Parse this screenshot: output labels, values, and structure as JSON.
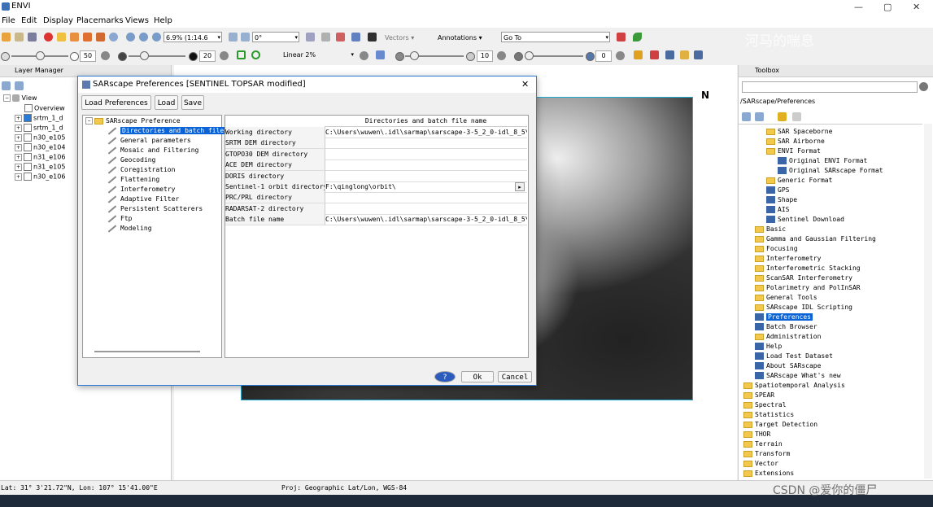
{
  "window": {
    "title": "ENVI",
    "min": "—",
    "max": "▢",
    "close": "✕"
  },
  "menu": [
    "File",
    "Edit",
    "Display",
    "Placemarks",
    "Views",
    "Help"
  ],
  "toolbar1": {
    "zoom": "6.9% (1:14.6",
    "rotation": "0°",
    "vectors": "Vectors ▾",
    "annotations": "Annotations ▾",
    "goto": "Go To"
  },
  "toolbar2": {
    "brightness": "50",
    "contrast": "20",
    "stretch": "Linear 2%",
    "sharpen": "10",
    "transparency": "0"
  },
  "layer_manager": {
    "title": "Layer Manager",
    "view": "View",
    "items": [
      "Overview",
      "srtm_1_d",
      "srtm_1_d",
      "n30_e105",
      "n30_e104",
      "n31_e106",
      "n31_e105",
      "n30_e106"
    ]
  },
  "toolbox": {
    "title": "Toolbox",
    "path": "/SARscape/Preferences",
    "items": [
      {
        "label": "SAR Spaceborne",
        "kind": "folder"
      },
      {
        "label": "SAR Airborne",
        "kind": "folder"
      },
      {
        "label": "ENVI Format",
        "kind": "folder"
      },
      {
        "label": "Original ENVI Format",
        "kind": "tool"
      },
      {
        "label": "Original SARscape Format",
        "kind": "tool"
      },
      {
        "label": "Generic Format",
        "kind": "folder"
      },
      {
        "label": "GPS",
        "kind": "tool"
      },
      {
        "label": "Shape",
        "kind": "tool"
      },
      {
        "label": "AIS",
        "kind": "tool"
      },
      {
        "label": "Sentinel Download",
        "kind": "tool"
      },
      {
        "label": "Basic",
        "kind": "folder"
      },
      {
        "label": "Gamma and Gaussian Filtering",
        "kind": "folder"
      },
      {
        "label": "Focusing",
        "kind": "folder"
      },
      {
        "label": "Interferometry",
        "kind": "folder"
      },
      {
        "label": "Interferometric Stacking",
        "kind": "folder"
      },
      {
        "label": "ScanSAR Interferometry",
        "kind": "folder"
      },
      {
        "label": "Polarimetry and PolInSAR",
        "kind": "folder"
      },
      {
        "label": "General Tools",
        "kind": "folder"
      },
      {
        "label": "SARscape IDL Scripting",
        "kind": "folder"
      },
      {
        "label": "Preferences",
        "kind": "tool",
        "selected": true
      },
      {
        "label": "Batch Browser",
        "kind": "tool"
      },
      {
        "label": "Administration",
        "kind": "folder"
      },
      {
        "label": "Help",
        "kind": "tool"
      },
      {
        "label": "Load Test Dataset",
        "kind": "tool"
      },
      {
        "label": "About SARscape",
        "kind": "tool"
      },
      {
        "label": "SARscape What's new",
        "kind": "tool"
      },
      {
        "label": "Spatiotemporal Analysis",
        "kind": "folder"
      },
      {
        "label": "SPEAR",
        "kind": "folder"
      },
      {
        "label": "Spectral",
        "kind": "folder"
      },
      {
        "label": "Statistics",
        "kind": "folder"
      },
      {
        "label": "Target Detection",
        "kind": "folder"
      },
      {
        "label": "THOR",
        "kind": "folder"
      },
      {
        "label": "Terrain",
        "kind": "folder"
      },
      {
        "label": "Transform",
        "kind": "folder"
      },
      {
        "label": "Vector",
        "kind": "folder"
      },
      {
        "label": "Extensions",
        "kind": "folder"
      }
    ]
  },
  "status": {
    "latlon": "Lat: 31° 3'21.72\"N, Lon: 107° 15'41.00\"E",
    "proj": "Proj: Geographic Lat/Lon, WGS-84"
  },
  "dialog": {
    "title": "SARscape Preferences [SENTINEL TOPSAR modified]",
    "load_preferences": "Load Preferences",
    "load": "Load",
    "save": "Save",
    "tree_root": "SARscape Preference",
    "tree_items": [
      "Directories and batch file n",
      "General parameters",
      "Mosaic and Filtering",
      "Geocoding",
      "Coregistration",
      "Flattening",
      "Interferometry",
      "Adaptive Filter",
      "Persistent Scatterers",
      "Ftp",
      "Modeling"
    ],
    "grid_header": "Directories and batch file name",
    "rows": [
      {
        "label": "Working directory",
        "value": "C:\\Users\\wuwen\\.idl\\sarmap\\sarscape-3-5_2_0-idl_8_5\\sar"
      },
      {
        "label": "SRTM DEM directory",
        "value": ""
      },
      {
        "label": "GTOPO30 DEM directory",
        "value": ""
      },
      {
        "label": "ACE DEM directory",
        "value": ""
      },
      {
        "label": "DORIS directory",
        "value": ""
      },
      {
        "label": "Sentinel-1 orbit directory",
        "value": "F:\\qinglong\\orbit\\"
      },
      {
        "label": "PRC/PRL directory",
        "value": ""
      },
      {
        "label": "RADARSAT-2 directory",
        "value": ""
      },
      {
        "label": "Batch file name",
        "value": "C:\\Users\\wuwen\\.idl\\sarmap\\sarscape-3-5_2_0-idl_8_5\\sar"
      }
    ],
    "help": "?",
    "ok": "Ok",
    "cancel": "Cancel"
  },
  "watermarks": {
    "top": "河马的喘息",
    "bottom": "CSDN @爱你的僵尸"
  }
}
